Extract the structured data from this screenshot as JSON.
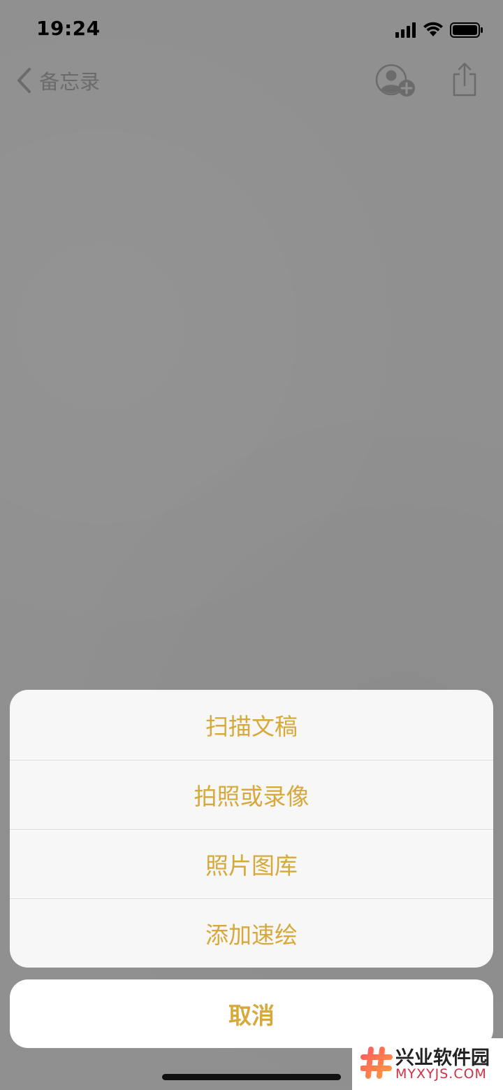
{
  "status_bar": {
    "time": "19:24",
    "signal_icon": "cellular-signal-icon",
    "wifi_icon": "wifi-icon",
    "battery_icon": "battery-icon"
  },
  "nav": {
    "back_label": "备忘录",
    "back_icon": "chevron-left-icon",
    "add_person_icon": "add-person-icon",
    "share_icon": "share-icon"
  },
  "action_sheet": {
    "items": [
      {
        "label": "扫描文稿"
      },
      {
        "label": "拍照或录像"
      },
      {
        "label": "照片图库"
      },
      {
        "label": "添加速绘"
      }
    ],
    "cancel_label": "取消"
  },
  "watermark": {
    "title": "兴业软件园",
    "url": "MYXYJS.COM"
  },
  "colors": {
    "accent": "#d7a93a",
    "dimmed_background": "#909090",
    "sheet_background": "#f7f7f7"
  }
}
